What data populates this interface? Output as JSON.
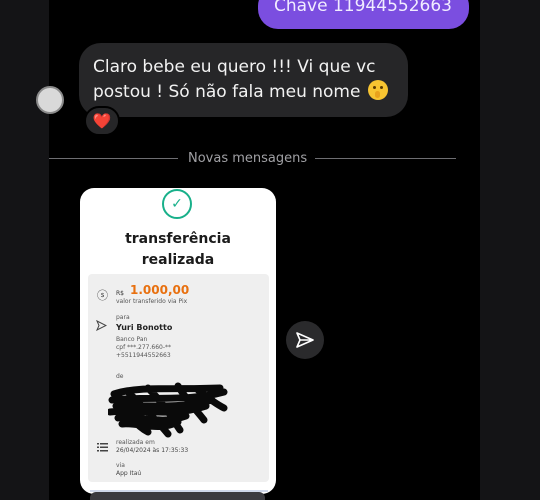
{
  "messages": {
    "outgoing_text": "Chave 11944552663",
    "incoming_line1": "Claro bebe eu quero !!! Vi que vc",
    "incoming_line2": "postou ! Só não fala meu nome",
    "incoming_emoji": "shushing-face-emoji",
    "reaction": "❤️",
    "divider": "Novas mensagens"
  },
  "receipt": {
    "title_line1": "transferência",
    "title_line2": "realizada",
    "currency": "R$",
    "amount": "1.000,00",
    "amount_caption": "valor transferido via Pix",
    "to_label": "para",
    "recipient_name": "Yuri Bonotto",
    "bank": "Banco Pan",
    "cpf": "cpf ***.277.660-**",
    "phone": "+5511944552663",
    "from_label": "de",
    "date_label": "realizada em",
    "date_value": "26/04/2024 às 17:35:33",
    "via_label": "via",
    "via_value": "App Itaú"
  },
  "colors": {
    "outgoing_bubble": "#7b4ee0",
    "incoming_bubble": "#262628",
    "amount": "#e8700f",
    "check": "#18b08a"
  }
}
